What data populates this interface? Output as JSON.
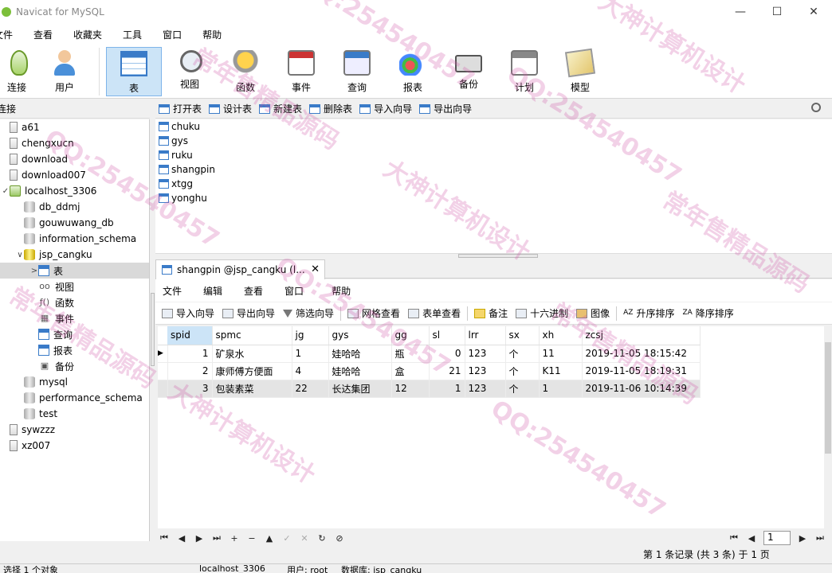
{
  "window": {
    "title": "Navicat for MySQL",
    "controls": [
      "—",
      "☐",
      "✕"
    ]
  },
  "menu": [
    "文件",
    "查看",
    "收藏夹",
    "工具",
    "窗口",
    "帮助"
  ],
  "toolbar": [
    {
      "label": "连接",
      "icon": "connection-icon"
    },
    {
      "label": "用户",
      "icon": "user-icon"
    },
    {
      "label": "表",
      "icon": "table-icon",
      "active": true
    },
    {
      "label": "视图",
      "icon": "view-icon"
    },
    {
      "label": "函数",
      "icon": "function-icon"
    },
    {
      "label": "事件",
      "icon": "event-icon"
    },
    {
      "label": "查询",
      "icon": "query-icon"
    },
    {
      "label": "报表",
      "icon": "report-icon"
    },
    {
      "label": "备份",
      "icon": "backup-icon"
    },
    {
      "label": "计划",
      "icon": "schedule-icon"
    },
    {
      "label": "模型",
      "icon": "model-icon"
    }
  ],
  "left_header": "连接",
  "tree": [
    {
      "label": "a61",
      "level": 0,
      "type": "server"
    },
    {
      "label": "chengxucn",
      "level": 0,
      "type": "server"
    },
    {
      "label": "download",
      "level": 0,
      "type": "server"
    },
    {
      "label": "download007",
      "level": 0,
      "type": "server"
    },
    {
      "label": "localhost_3306",
      "level": 0,
      "type": "server-open",
      "twisty": "✓"
    },
    {
      "label": "db_ddmj",
      "level": 1,
      "type": "db"
    },
    {
      "label": "gouwuwang_db",
      "level": 1,
      "type": "db"
    },
    {
      "label": "information_schema",
      "level": 1,
      "type": "db"
    },
    {
      "label": "jsp_cangku",
      "level": 1,
      "type": "db-open",
      "twisty": "∨"
    },
    {
      "label": "表",
      "level": 2,
      "type": "tables",
      "twisty": ">",
      "selected": true
    },
    {
      "label": "视图",
      "level": 2,
      "type": "glyph",
      "glyph": "oo"
    },
    {
      "label": "函数",
      "level": 2,
      "type": "glyph",
      "glyph": "ƒ()"
    },
    {
      "label": "事件",
      "level": 2,
      "type": "glyph",
      "glyph": "▦"
    },
    {
      "label": "查询",
      "level": 2,
      "type": "tables"
    },
    {
      "label": "报表",
      "level": 2,
      "type": "tables"
    },
    {
      "label": "备份",
      "level": 2,
      "type": "glyph",
      "glyph": "▣"
    },
    {
      "label": "mysql",
      "level": 1,
      "type": "db"
    },
    {
      "label": "performance_schema",
      "level": 1,
      "type": "db"
    },
    {
      "label": "test",
      "level": 1,
      "type": "db"
    },
    {
      "label": "sywzzz",
      "level": 0,
      "type": "server"
    },
    {
      "label": "xz007",
      "level": 0,
      "type": "server"
    }
  ],
  "object_toolbar": [
    "打开表",
    "设计表",
    "新建表",
    "删除表",
    "导入向导",
    "导出向导"
  ],
  "tables": [
    "chuku",
    "gys",
    "ruku",
    "shangpin",
    "xtgg",
    "yonghu"
  ],
  "tab": {
    "label": "shangpin @jsp_cangku (l...",
    "close": "✕"
  },
  "inner_menu": [
    "文件",
    "编辑",
    "查看",
    "窗口",
    "帮助"
  ],
  "grid_toolbar": [
    "导入向导",
    "导出向导",
    "筛选向导",
    "网格查看",
    "表单查看",
    "备注",
    "十六进制",
    "图像",
    "升序排序",
    "降序排序"
  ],
  "grid": {
    "columns": [
      "spid",
      "spmc",
      "jg",
      "gys",
      "gg",
      "sl",
      "lrr",
      "sx",
      "xh",
      "zcsj"
    ],
    "rows": [
      [
        "1",
        "矿泉水",
        "1",
        "娃哈哈",
        "瓶",
        "0",
        "123",
        "个",
        "11",
        "2019-11-05 18:15:42"
      ],
      [
        "2",
        "康师傅方便面",
        "4",
        "娃哈哈",
        "盒",
        "21",
        "123",
        "个",
        "K11",
        "2019-11-05 18:19:31"
      ],
      [
        "3",
        "包装素菜",
        "22",
        "长达集团",
        "12",
        "1",
        "123",
        "个",
        "1",
        "2019-11-06 10:14:39"
      ]
    ]
  },
  "nav_buttons": [
    "⏮",
    "◀",
    "▶",
    "⏭",
    "+",
    "−",
    "▲",
    "✓",
    "✕",
    "↻",
    "⊘"
  ],
  "pager": {
    "page": "1"
  },
  "record_info": "第 1 条记录 (共 3 条) 于 1 页",
  "status": {
    "left": "选择 1 个对象",
    "connection": "localhost_3306",
    "user": "用户: root",
    "database": "数据库: jsp_cangku"
  },
  "watermark": [
    "QQ:254540457",
    "大神计算机设计",
    "常年售精品源码"
  ]
}
